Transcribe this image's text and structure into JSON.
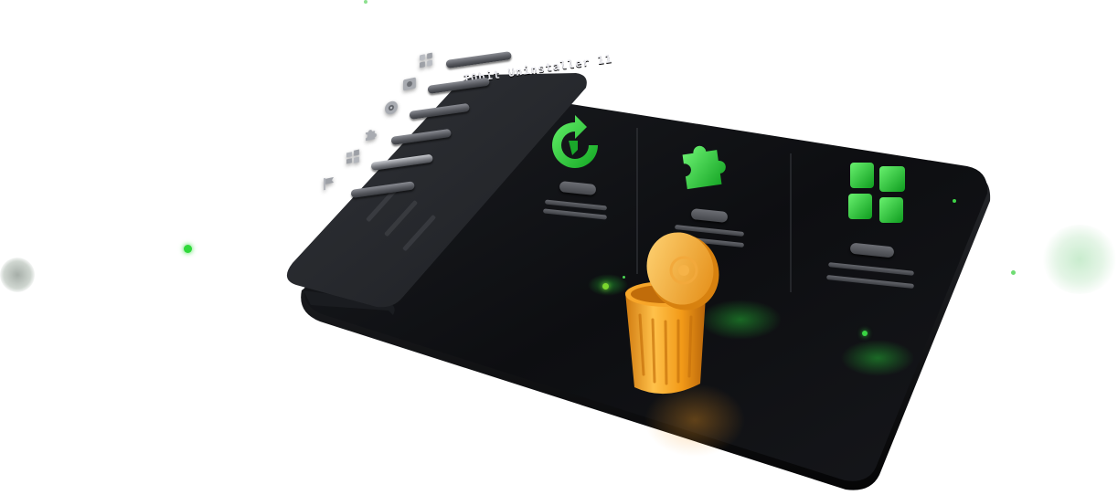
{
  "app": {
    "title": "IObit Uninstaller 11"
  },
  "sidebar": {
    "items": [
      {
        "icon": "apps-grid-icon"
      },
      {
        "icon": "image-icon"
      },
      {
        "icon": "disc-icon"
      },
      {
        "icon": "puzzle-icon"
      },
      {
        "icon": "windows-icon"
      },
      {
        "icon": "flag-icon"
      }
    ]
  },
  "features": [
    {
      "icon": "refresh-icon"
    },
    {
      "icon": "puzzle-icon"
    },
    {
      "icon": "apps-grid-icon"
    }
  ],
  "colors": {
    "accent_green": "#2fd93a",
    "board": "#0d0e11",
    "card": "#2a2c31",
    "trash_orange": "#f5a01f"
  }
}
